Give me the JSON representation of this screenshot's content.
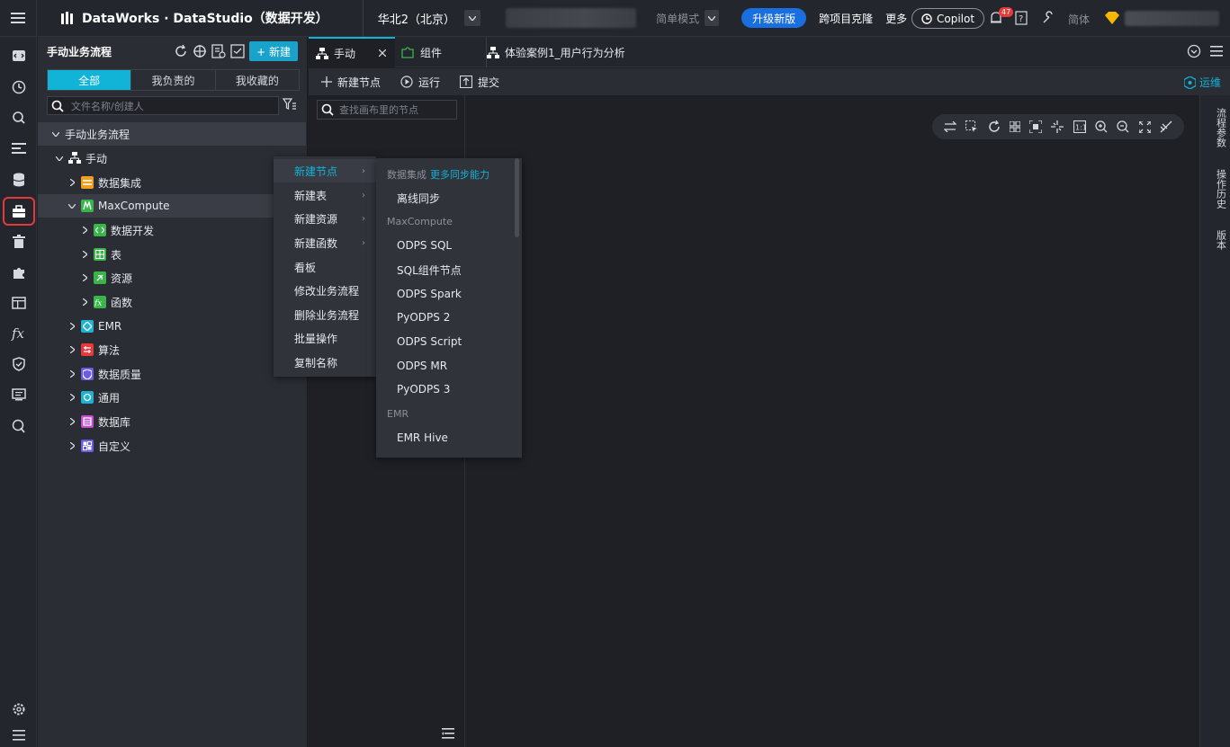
{
  "topbar": {
    "brand": "DataWorks · DataStudio（数据开发）",
    "region": "华北2（北京）",
    "mode": "简单模式",
    "upgrade": "升级新版",
    "clone": "跨项目克隆",
    "more": "更多",
    "copilot": "Copilot",
    "notifications": "47",
    "lang": "简体"
  },
  "tree": {
    "title": "手动业务流程",
    "new_button": "+ 新建",
    "filters": [
      "全部",
      "我负责的",
      "我收藏的"
    ],
    "search_placeholder": "文件名称/创建人",
    "rows": [
      {
        "label": "手动业务流程"
      },
      {
        "label": "手动"
      },
      {
        "label": "数据集成"
      },
      {
        "label": "MaxCompute"
      },
      {
        "label": "数据开发"
      },
      {
        "label": "表"
      },
      {
        "label": "资源"
      },
      {
        "label": "函数"
      },
      {
        "label": "EMR"
      },
      {
        "label": "算法"
      },
      {
        "label": "数据质量"
      },
      {
        "label": "通用"
      },
      {
        "label": "数据库"
      },
      {
        "label": "自定义"
      }
    ]
  },
  "tabs": [
    {
      "label": "手动"
    },
    {
      "label": "组件"
    },
    {
      "label": "体验案例1_用户行为分析"
    }
  ],
  "toolbar": {
    "new_node": "新建节点",
    "run": "运行",
    "submit": "提交",
    "ops": "运维"
  },
  "canvas": {
    "search_placeholder": "查找画布里的节点"
  },
  "right_rail": [
    "流程参数",
    "操作历史",
    "版本"
  ],
  "context_menu": [
    {
      "label": "新建节点",
      "submenu": true
    },
    {
      "label": "新建表",
      "submenu": true
    },
    {
      "label": "新建资源",
      "submenu": true
    },
    {
      "label": "新建函数",
      "submenu": true
    },
    {
      "label": "看板"
    },
    {
      "label": "修改业务流程"
    },
    {
      "label": "删除业务流程"
    },
    {
      "label": "批量操作"
    },
    {
      "label": "复制名称"
    }
  ],
  "submenu": {
    "group1": "数据集成",
    "group1_more": "更多同步能力",
    "offline_sync": "离线同步",
    "group2": "MaxCompute",
    "items2": [
      "ODPS SQL",
      "SQL组件节点",
      "ODPS Spark",
      "PyODPS 2",
      "ODPS Script",
      "ODPS MR",
      "PyODPS 3"
    ],
    "group3": "EMR",
    "items3": [
      "EMR Hive"
    ]
  },
  "colors": {
    "accent": "#11b3d6",
    "upgrade": "#1a6fe0",
    "highlight_border": "#e5393a"
  }
}
